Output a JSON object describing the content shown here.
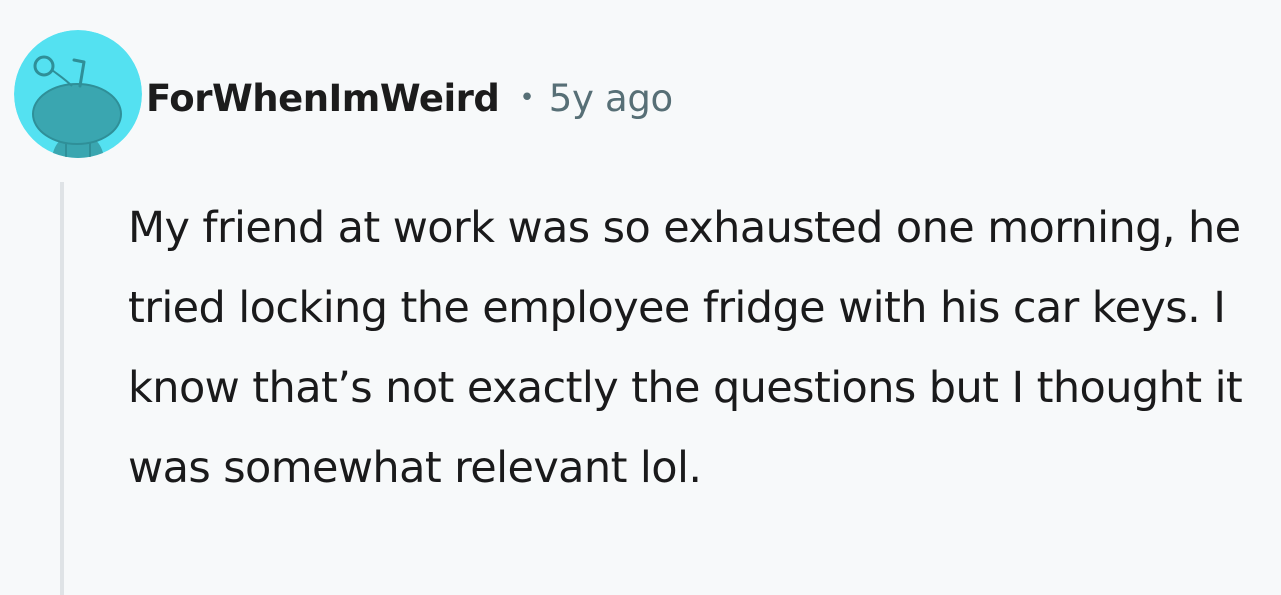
{
  "comment": {
    "author": "ForWhenImWeird",
    "separator": "•",
    "age": "5y ago",
    "body": "My friend at work was so exhausted one morning, he tried locking the employee fridge with his car keys. I know that’s not exactly the questions but I thought it was somewhat relevant lol.",
    "avatar": {
      "icon": "reddit-snoo-icon",
      "background": "#54e1f1",
      "figure_color": "#3aa6b0"
    }
  },
  "colors": {
    "page_background": "#f7f9fa",
    "author_text": "#1c1c1c",
    "meta_text": "#576f76",
    "body_text": "#1a1a1b",
    "thread_line": "#dfe3e6"
  }
}
